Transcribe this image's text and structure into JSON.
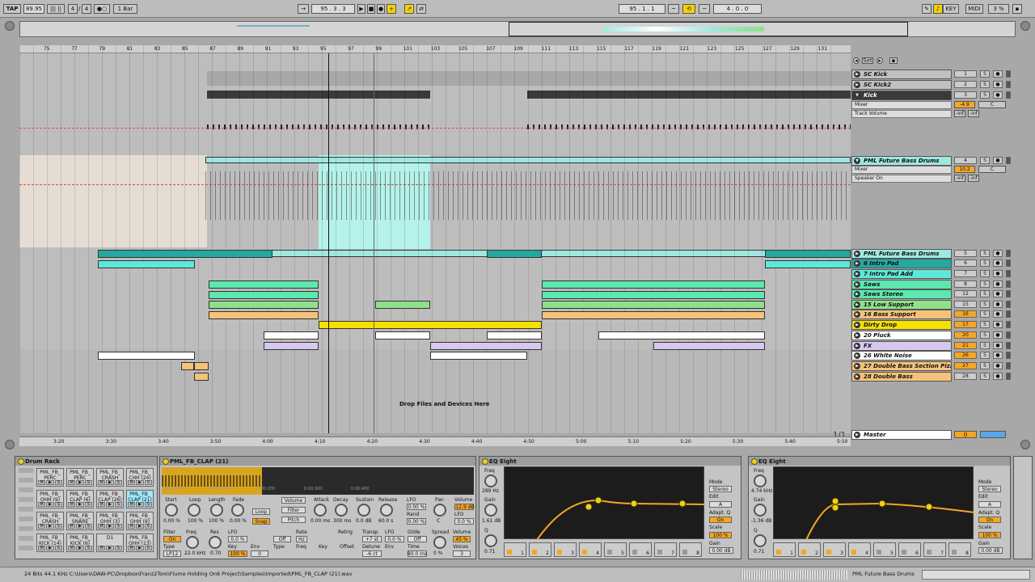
{
  "transport": {
    "tap": "TAP",
    "tempo": "89.95",
    "sig_num": "4",
    "sig_den": "4",
    "quant": "1 Bar",
    "pos": "95 . 3 . 3",
    "loop_start": "95 . 1 . 1",
    "loop_len": "4 . 0 . 0",
    "key": "KEY",
    "midi": "MIDI",
    "cpu": "3 %"
  },
  "ruler": {
    "bars": [
      "75",
      "77",
      "79",
      "81",
      "83",
      "85",
      "87",
      "89",
      "91",
      "93",
      "95",
      "97",
      "99",
      "101",
      "103",
      "105",
      "107",
      "109",
      "111",
      "113",
      "115",
      "117",
      "119",
      "121",
      "123",
      "125",
      "127",
      "129",
      "131"
    ]
  },
  "time": {
    "marks": [
      "3:20",
      "3:30",
      "3:40",
      "3:50",
      "4:00",
      "4:10",
      "4:20",
      "4:30",
      "4:40",
      "4:50",
      "5:00",
      "5:10",
      "5:20",
      "5:30",
      "5:40",
      "5:50"
    ],
    "page": "1/1"
  },
  "tracks": [
    {
      "name": "SC Kick",
      "num": "1",
      "color": "#c0c0c0"
    },
    {
      "name": "SC Kick2",
      "num": "2",
      "color": "#c0c0c0"
    },
    {
      "name": "Kick",
      "num": "3",
      "color": "#3a3a3a",
      "dark": true,
      "mixer": "Mixer",
      "param": "Track Volume",
      "vol": "-4.9",
      "pan": "C",
      "inf1": "-inf",
      "inf2": "-inf"
    },
    {
      "name": "PML Future Bass Drums",
      "num": "4",
      "color": "#9fe8e0",
      "mixer": "Mixer",
      "param": "Speaker On",
      "vol": "10.2",
      "pan": "C",
      "inf1": "-inf",
      "inf2": "-inf"
    },
    {
      "name": "PML Future Bass Drums",
      "num": "5",
      "color": "#9fe8e0"
    },
    {
      "name": "6 Intro Pad",
      "num": "6",
      "color": "#23a9a0"
    },
    {
      "name": "7 Intro Pad Add",
      "num": "7",
      "color": "#5ce8da"
    },
    {
      "name": "Saws",
      "num": "8",
      "color": "#5ce8b0"
    },
    {
      "name": "Saws Stereo",
      "num": "12",
      "color": "#5ce8b0"
    },
    {
      "name": "15 Low Support",
      "num": "15",
      "color": "#8fe08a"
    },
    {
      "name": "16 Bass Support",
      "num": "16",
      "color": "#f5c27a"
    },
    {
      "name": "Dirty Drop",
      "num": "17",
      "color": "#f5e000"
    },
    {
      "name": "20 Pluck",
      "num": "20",
      "color": "#ffffff"
    },
    {
      "name": "FX",
      "num": "21",
      "color": "#d8c8f0"
    },
    {
      "name": "26 White Noise",
      "num": "26",
      "color": "#ffffff"
    },
    {
      "name": "27 Double Bass Section Pizzic",
      "num": "27",
      "color": "#f5c27a"
    },
    {
      "name": "28 Double Bass",
      "num": "28",
      "color": "#f5c27a"
    }
  ],
  "drop_text": "Drop Files and Devices Here",
  "master": {
    "name": "Master",
    "num": "0"
  },
  "drum_rack": {
    "title": "Drum Rack",
    "pads": [
      "PML_FB_ PERC",
      "PML_FB_ PERC",
      "PML_FB_ CRASH",
      "PML_FB_ CHH (24)",
      "PML_FB_ OHH (9)",
      "PML_FB_ CLAP (6)",
      "PML_FB_ CLAP (26)",
      "PML_FB_ CLAP (21)",
      "PML_FB_ CRASH",
      "PML_FB_ SNARE",
      "PML_FB_ OHH (3)",
      "PML_FB_ OHH (9)",
      "PML_FB_ KICK (14)",
      "PML_FB_ KICK (6)",
      "D1",
      "PML_FB_ OHH (13)"
    ],
    "m": "M",
    "s": "S"
  },
  "sampler": {
    "title": "PML_FB_CLAP (21)",
    "times": [
      "0:00:000",
      "0:00:100",
      "0:00:200",
      "0:00:300",
      "0:00:400"
    ],
    "labels": {
      "start": "Start",
      "loop": "Loop",
      "length": "Length",
      "fade": "Fade",
      "loopbtn": "Loop",
      "snap": "Snap",
      "volume": "Volume",
      "filter": "Filter",
      "pitch": "Pitch",
      "attack": "Attack",
      "decay": "Decay",
      "sustain": "Sustain",
      "release": "Release",
      "lfo": "LFO",
      "rand": "Rand",
      "pan": "Pan",
      "vol": "Vol",
      "filterL": "Filter",
      "type": "Type",
      "freq": "Freq",
      "res": "Res",
      "key": "Key",
      "env": "Env",
      "rate": "Rate",
      "offset": "Offset",
      "retrig": "Retrig",
      "transp": "Transp",
      "detune": "Detune",
      "glide": "Glide",
      "time": "Time",
      "spread": "Spread",
      "voices": "Voices",
      "lfoL": "LFO",
      "volL": "Volume"
    },
    "values": {
      "start": "0.00 %",
      "loop": "100 %",
      "length": "100 %",
      "fade": "0.00 %",
      "attack": "0.00 ms",
      "decay": "300 ms",
      "sustain": "0.0 dB",
      "release": "60.0 s",
      "lfo": "0.00 %",
      "rand": "0.00 %",
      "pan": "C",
      "lfo2": "0.0 %",
      "vol": "-12.9 dB",
      "volpct": "45 %",
      "on": "On",
      "lp": "LP12",
      "freq": "22.0 kHz",
      "res": "0.70",
      "key": "0.0 %",
      "keyv": "100 %",
      "env": "0",
      "off": "Off",
      "fixed": "Hz",
      "transp": "+7 st",
      "detune": "-6 ct",
      "lfo3": "0.0 %",
      "glide": "Off",
      "time": "80.0 ms",
      "spread": "0 %",
      "voices": "3"
    }
  },
  "eq1": {
    "title": "EQ Eight",
    "freq": "Freq",
    "freqv": "289 Hz",
    "gain": "Gain",
    "gainv": "1.61 dB",
    "q": "Q",
    "qv": "0.71",
    "mode": "Mode",
    "modev": "Stereo",
    "edit": "Edit",
    "editv": "A",
    "adapt": "Adapt. Q",
    "adaptv": "On",
    "scale": "Scale",
    "scalev": "100 %",
    "gainout": "Gain",
    "gainoutv": "0.00 dB"
  },
  "eq2": {
    "title": "EQ Eight",
    "freq": "Freq",
    "freqv": "4.74 kHz",
    "gain": "Gain",
    "gainv": "-1.36 dB",
    "q": "Q",
    "qv": "0.71",
    "mode": "Mode",
    "modev": "Stereo",
    "edit": "Edit",
    "editv": "A",
    "adapt": "Adapt. Q",
    "adaptv": "On",
    "scale": "Scale",
    "scalev": "100 %",
    "gainout": "Gain",
    "gainoutv": "0.00 dB"
  },
  "status": {
    "path": "24 Bits 44.1 KHz C:\\Users\\DAW-PC\\Dropbox\\Franz2Tom\\Flume Holding On6 Project\\Samples\\Imported\\PML_FB_CLAP (21).wav",
    "track": "PML Future Bass Drums"
  }
}
